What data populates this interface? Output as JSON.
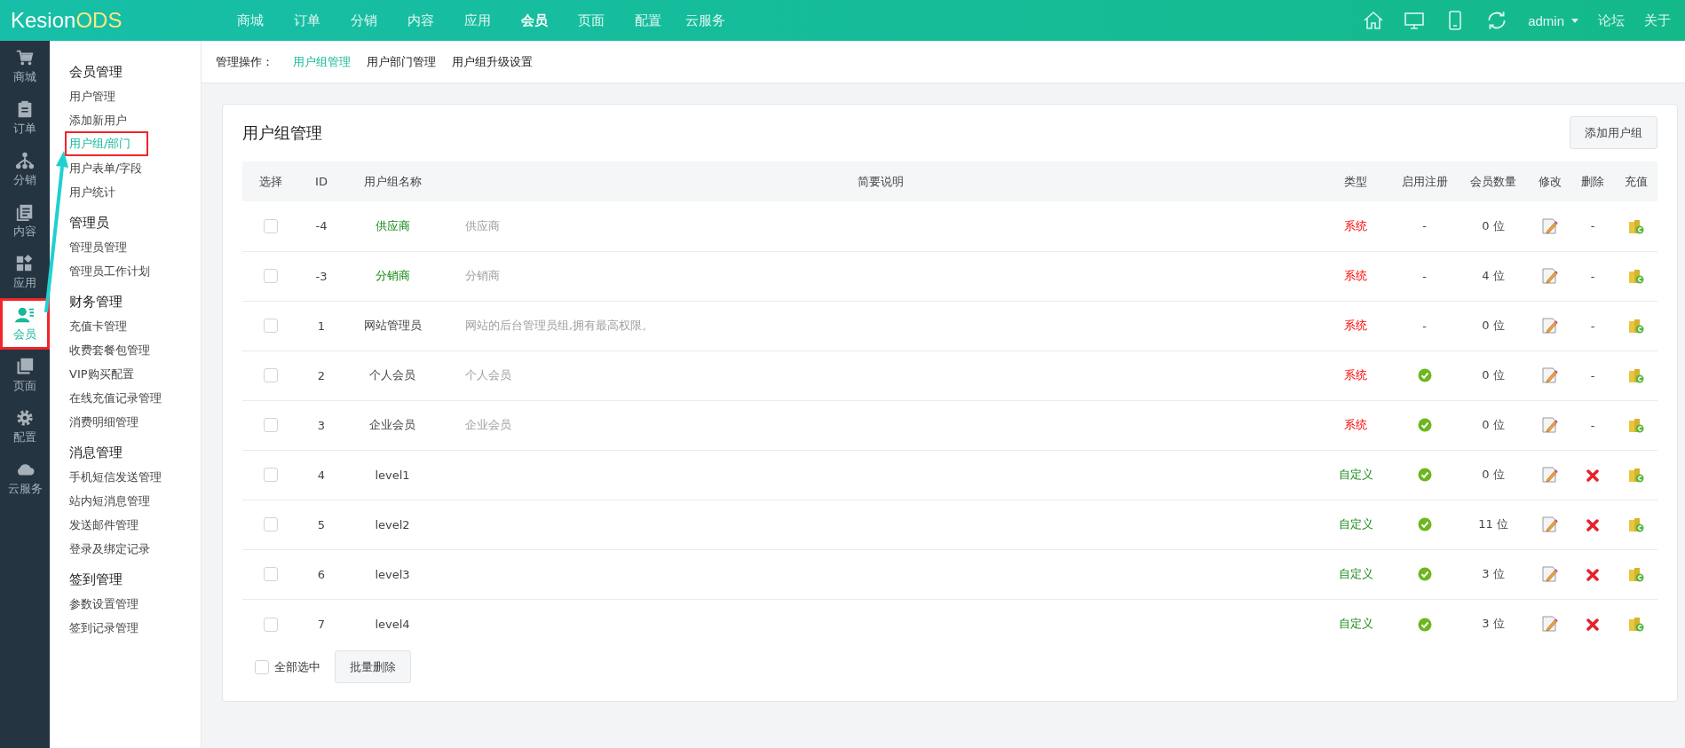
{
  "brand": {
    "name": "Kesion",
    "suffix": "ODS"
  },
  "top_nav": [
    {
      "label": "商城",
      "selected": false
    },
    {
      "label": "订单",
      "selected": false
    },
    {
      "label": "分销",
      "selected": false
    },
    {
      "label": "内容",
      "selected": false
    },
    {
      "label": "应用",
      "selected": false
    },
    {
      "label": "会员",
      "selected": true
    },
    {
      "label": "页面",
      "selected": false
    },
    {
      "label": "配置",
      "selected": false
    },
    {
      "label": "云服务",
      "selected": false
    }
  ],
  "top_right": {
    "user": "admin",
    "links": [
      "论坛",
      "关于"
    ]
  },
  "icon_sidebar": [
    {
      "label": "商城",
      "kind": "cart",
      "selected": false,
      "annotated": false
    },
    {
      "label": "订单",
      "kind": "clipboard",
      "selected": false,
      "annotated": false
    },
    {
      "label": "分销",
      "kind": "hierarchy",
      "selected": false,
      "annotated": false
    },
    {
      "label": "内容",
      "kind": "document",
      "selected": false,
      "annotated": false
    },
    {
      "label": "应用",
      "kind": "apps",
      "selected": false,
      "annotated": false
    },
    {
      "label": "会员",
      "kind": "member",
      "selected": true,
      "annotated": true
    },
    {
      "label": "页面",
      "kind": "pages",
      "selected": false,
      "annotated": false
    },
    {
      "label": "配置",
      "kind": "gear",
      "selected": false,
      "annotated": false
    },
    {
      "label": "云服务",
      "kind": "cloud",
      "selected": false,
      "annotated": false
    }
  ],
  "submenu": [
    {
      "title": "会员管理",
      "items": [
        {
          "label": "用户管理",
          "selected": false,
          "annotated": false
        },
        {
          "label": "添加新用户",
          "selected": false,
          "annotated": false
        },
        {
          "label": "用户组/部门",
          "selected": true,
          "annotated": true
        },
        {
          "label": "用户表单/字段",
          "selected": false,
          "annotated": false
        },
        {
          "label": "用户统计",
          "selected": false,
          "annotated": false
        }
      ]
    },
    {
      "title": "管理员",
      "items": [
        {
          "label": "管理员管理",
          "selected": false,
          "annotated": false
        },
        {
          "label": "管理员工作计划",
          "selected": false,
          "annotated": false
        }
      ]
    },
    {
      "title": "财务管理",
      "items": [
        {
          "label": "充值卡管理",
          "selected": false,
          "annotated": false
        },
        {
          "label": "收费套餐包管理",
          "selected": false,
          "annotated": false
        },
        {
          "label": "VIP购买配置",
          "selected": false,
          "annotated": false
        },
        {
          "label": "在线充值记录管理",
          "selected": false,
          "annotated": false
        },
        {
          "label": "消费明细管理",
          "selected": false,
          "annotated": false
        }
      ]
    },
    {
      "title": "消息管理",
      "items": [
        {
          "label": "手机短信发送管理",
          "selected": false,
          "annotated": false
        },
        {
          "label": "站内短消息管理",
          "selected": false,
          "annotated": false
        },
        {
          "label": "发送邮件管理",
          "selected": false,
          "annotated": false
        },
        {
          "label": "登录及绑定记录",
          "selected": false,
          "annotated": false
        }
      ]
    },
    {
      "title": "签到管理",
      "items": [
        {
          "label": "参数设置管理",
          "selected": false,
          "annotated": false
        },
        {
          "label": "签到记录管理",
          "selected": false,
          "annotated": false
        }
      ]
    }
  ],
  "annotation_arrow": true,
  "subheader": {
    "label": "管理操作：",
    "tabs": [
      {
        "label": "用户组管理",
        "selected": true
      },
      {
        "label": "用户部门管理",
        "selected": false
      },
      {
        "label": "用户组升级设置",
        "selected": false
      }
    ]
  },
  "card": {
    "title": "用户组管理",
    "add_button": "添加用户组"
  },
  "table": {
    "columns": [
      "选择",
      "ID",
      "用户组名称",
      "简要说明",
      "类型",
      "启用注册",
      "会员数量",
      "修改",
      "删除",
      "充值"
    ],
    "rows": [
      {
        "checked": false,
        "id": "-4",
        "name": "供应商",
        "name_highlight": true,
        "description": "供应商",
        "type": {
          "label": "系统",
          "kind": "system"
        },
        "registration": {
          "enabled": false,
          "text": "-"
        },
        "members": "0 位",
        "delete": {
          "deletable": false,
          "text": "-"
        }
      },
      {
        "checked": false,
        "id": "-3",
        "name": "分销商",
        "name_highlight": true,
        "description": "分销商",
        "type": {
          "label": "系统",
          "kind": "system"
        },
        "registration": {
          "enabled": false,
          "text": "-"
        },
        "members": "4 位",
        "delete": {
          "deletable": false,
          "text": "-"
        }
      },
      {
        "checked": false,
        "id": "1",
        "name": "网站管理员",
        "name_highlight": false,
        "description": "网站的后台管理员组,拥有最高权限。",
        "type": {
          "label": "系统",
          "kind": "system"
        },
        "registration": {
          "enabled": false,
          "text": "-"
        },
        "members": "0 位",
        "delete": {
          "deletable": false,
          "text": "-"
        }
      },
      {
        "checked": false,
        "id": "2",
        "name": "个人会员",
        "name_highlight": false,
        "description": "个人会员",
        "type": {
          "label": "系统",
          "kind": "system"
        },
        "registration": {
          "enabled": true
        },
        "members": "0 位",
        "delete": {
          "deletable": false,
          "text": "-"
        }
      },
      {
        "checked": false,
        "id": "3",
        "name": "企业会员",
        "name_highlight": false,
        "description": "企业会员",
        "type": {
          "label": "系统",
          "kind": "system"
        },
        "registration": {
          "enabled": true
        },
        "members": "0 位",
        "delete": {
          "deletable": false,
          "text": "-"
        }
      },
      {
        "checked": false,
        "id": "4",
        "name": "level1",
        "name_highlight": false,
        "type": {
          "label": "自定义",
          "kind": "custom"
        },
        "registration": {
          "enabled": true
        },
        "members": "0 位",
        "delete": {
          "deletable": true
        }
      },
      {
        "checked": false,
        "id": "5",
        "name": "level2",
        "name_highlight": false,
        "type": {
          "label": "自定义",
          "kind": "custom"
        },
        "registration": {
          "enabled": true
        },
        "members": "11 位",
        "delete": {
          "deletable": true
        }
      },
      {
        "checked": false,
        "id": "6",
        "name": "level3",
        "name_highlight": false,
        "type": {
          "label": "自定义",
          "kind": "custom"
        },
        "registration": {
          "enabled": true
        },
        "members": "3 位",
        "delete": {
          "deletable": true
        }
      },
      {
        "checked": false,
        "id": "7",
        "name": "level4",
        "name_highlight": false,
        "type": {
          "label": "自定义",
          "kind": "custom"
        },
        "registration": {
          "enabled": true
        },
        "members": "3 位",
        "delete": {
          "deletable": true
        }
      }
    ]
  },
  "footer": {
    "select_all": {
      "label": "全部选中",
      "checked": false
    },
    "batch_delete": "批量删除"
  }
}
